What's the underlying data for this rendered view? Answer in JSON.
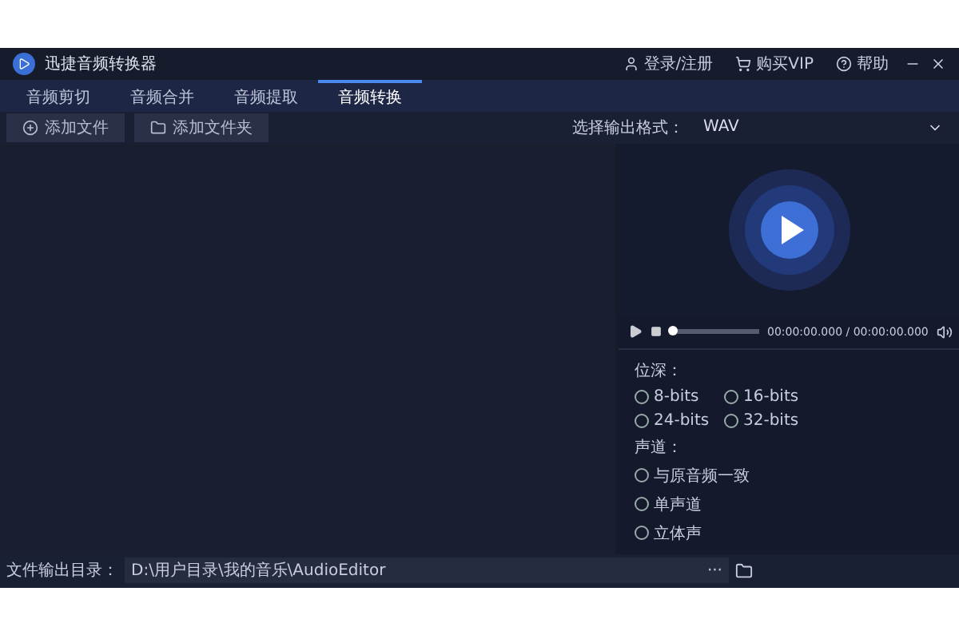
{
  "window": {
    "title": "迅捷音频转换器",
    "actions": [
      {
        "kind": "user",
        "label": "登录/注册"
      },
      {
        "kind": "cart",
        "label": "购买VIP"
      },
      {
        "kind": "help",
        "label": "帮助"
      }
    ]
  },
  "tabs": [
    {
      "label": "音频剪切",
      "selected": false
    },
    {
      "label": "音频合并",
      "selected": false
    },
    {
      "label": "音频提取",
      "selected": false
    },
    {
      "label": "音频转换",
      "selected": true
    }
  ],
  "toolbar": {
    "buttons": [
      {
        "kind": "file",
        "label": "添加文件"
      },
      {
        "kind": "folder",
        "label": "添加文件夹"
      }
    ],
    "format_label": "选择输出格式：",
    "format_value": "WAV"
  },
  "player": {
    "level": 0.03,
    "time": "00:00:00.000 / 00:00:00.000"
  },
  "options": [
    {
      "heading": "位深：",
      "kind": "grid",
      "choices": [
        {
          "label": "8-bits",
          "selected": false
        },
        {
          "label": "16-bits",
          "selected": false
        },
        {
          "label": "24-bits",
          "selected": false
        },
        {
          "label": "32-bits",
          "selected": false
        }
      ]
    },
    {
      "heading": "声道：",
      "kind": "list",
      "choices": [
        {
          "label": "与原音频一致",
          "selected": false
        },
        {
          "label": "单声道",
          "selected": false
        },
        {
          "label": "立体声",
          "selected": false
        }
      ]
    }
  ],
  "output": {
    "label": "文件输出目录：",
    "value": "D:\\用户目录\\我的音乐\\AudioEditor",
    "more": "···"
  }
}
